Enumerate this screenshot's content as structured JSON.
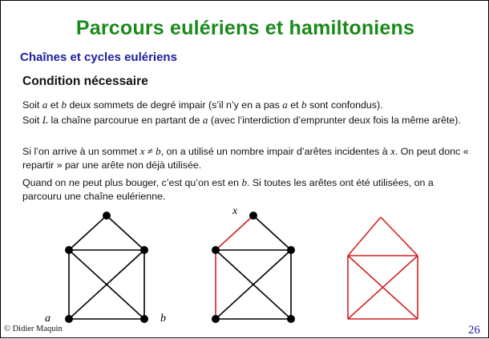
{
  "title": "Parcours eulériens et hamiltoniens",
  "subtitle": "Chaînes et cycles eulériens",
  "section": "Condition nécessaire",
  "p1": {
    "t1": "Soit ",
    "a": "a",
    "t2": " et ",
    "b": "b",
    "t3": " deux sommets de degré impair (s’il n’y en a pas ",
    "a2": "a",
    "t4": " et ",
    "b2": "b",
    "t5": " sont confondus)."
  },
  "p2": {
    "t1": "Soit ",
    "L": "L",
    "t2": " la chaîne parcourue en partant de ",
    "a": "a",
    "t3": " (avec l’interdiction d’emprunter deux fois la même arête)."
  },
  "p3": {
    "t1": "Si l’on arrive à un sommet ",
    "x": "x ≠ b",
    "t2": ", on a utilisé un nombre impair d’arêtes incidentes à ",
    "x2": "x",
    "t3": ". On peut donc « repartir » par une arête non déjà utilisée."
  },
  "p4": {
    "t1": "Quand on ne peut plus bouger, c’est qu’on est en ",
    "b": "b",
    "t2": ". Si toutes les arêtes ont été utilisées, on a parcouru une chaîne eulérienne."
  },
  "labels": {
    "a": "a",
    "b": "b",
    "x": "x"
  },
  "footer": {
    "credit": "© Didier Maquin",
    "page": "26"
  },
  "colors": {
    "title": "#1a8a1a",
    "subtitle": "#1f1f9e",
    "red": "#d42020",
    "black": "#000000"
  }
}
